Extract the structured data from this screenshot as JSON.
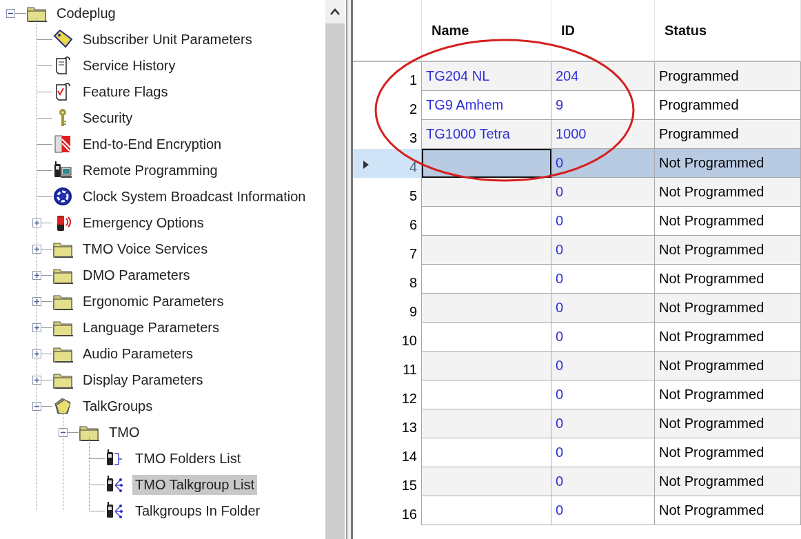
{
  "tree": [
    {
      "label": "Codeplug",
      "kind": "folder",
      "expanded": true,
      "selected": false,
      "children": [
        {
          "label": "Subscriber Unit Parameters",
          "kind": "tag",
          "selected": false
        },
        {
          "label": "Service History",
          "kind": "document",
          "selected": false
        },
        {
          "label": "Feature Flags",
          "kind": "checklist",
          "selected": false
        },
        {
          "label": "Security",
          "kind": "key",
          "selected": false
        },
        {
          "label": "End-to-End Encryption",
          "kind": "encryption",
          "selected": false
        },
        {
          "label": "Remote Programming",
          "kind": "remote",
          "selected": false
        },
        {
          "label": "Clock System Broadcast Information",
          "kind": "clock",
          "selected": false
        },
        {
          "label": "Emergency Options",
          "kind": "emergency",
          "expanded": false,
          "selected": false
        },
        {
          "label": "TMO Voice Services",
          "kind": "folder",
          "expanded": false,
          "selected": false
        },
        {
          "label": "DMO Parameters",
          "kind": "folder",
          "expanded": false,
          "selected": false
        },
        {
          "label": "Ergonomic Parameters",
          "kind": "folder",
          "expanded": false,
          "selected": false
        },
        {
          "label": "Language Parameters",
          "kind": "folder",
          "expanded": false,
          "selected": false
        },
        {
          "label": "Audio Parameters",
          "kind": "folder",
          "expanded": false,
          "selected": false
        },
        {
          "label": "Display Parameters",
          "kind": "folder",
          "expanded": false,
          "selected": false
        },
        {
          "label": "TalkGroups",
          "kind": "group",
          "expanded": true,
          "selected": false,
          "children": [
            {
              "label": "TMO",
              "kind": "folder",
              "expanded": true,
              "selected": false,
              "children": [
                {
                  "label": "TMO Folders List",
                  "kind": "list",
                  "selected": false
                },
                {
                  "label": "TMO Talkgroup List",
                  "kind": "talkgroups",
                  "selected": true
                },
                {
                  "label": "Talkgroups In Folder",
                  "kind": "talkgroups",
                  "selected": false
                }
              ]
            }
          ]
        }
      ]
    }
  ],
  "grid": {
    "columns": [
      "Name",
      "ID",
      "Status"
    ],
    "annotation": {
      "kind": "ellipse"
    },
    "rows": [
      {
        "number": "1",
        "name": "TG204 NL",
        "id": "204",
        "status": "Programmed",
        "selected": false
      },
      {
        "number": "2",
        "name": "TG9 Amhem",
        "id": "9",
        "status": "Programmed",
        "selected": false
      },
      {
        "number": "3",
        "name": "TG1000 Tetra",
        "id": "1000",
        "status": "Programmed",
        "selected": false
      },
      {
        "number": "4",
        "id": "0",
        "status": "Not Programmed",
        "selected": true
      },
      {
        "number": "5",
        "id": "0",
        "status": "Not Programmed",
        "selected": false
      },
      {
        "number": "6",
        "id": "0",
        "status": "Not Programmed",
        "selected": false
      },
      {
        "number": "7",
        "id": "0",
        "status": "Not Programmed",
        "selected": false
      },
      {
        "number": "8",
        "id": "0",
        "status": "Not Programmed",
        "selected": false
      },
      {
        "number": "9",
        "id": "0",
        "status": "Not Programmed",
        "selected": false
      },
      {
        "number": "10",
        "id": "0",
        "status": "Not Programmed",
        "selected": false
      },
      {
        "number": "11",
        "id": "0",
        "status": "Not Programmed",
        "selected": false
      },
      {
        "number": "12",
        "id": "0",
        "status": "Not Programmed",
        "selected": false
      },
      {
        "number": "13",
        "id": "0",
        "status": "Not Programmed",
        "selected": false
      },
      {
        "number": "14",
        "id": "0",
        "status": "Not Programmed",
        "selected": false
      },
      {
        "number": "15",
        "id": "0",
        "status": "Not Programmed",
        "selected": false
      },
      {
        "number": "16",
        "id": "0",
        "status": "Not Programmed",
        "selected": false
      }
    ]
  }
}
